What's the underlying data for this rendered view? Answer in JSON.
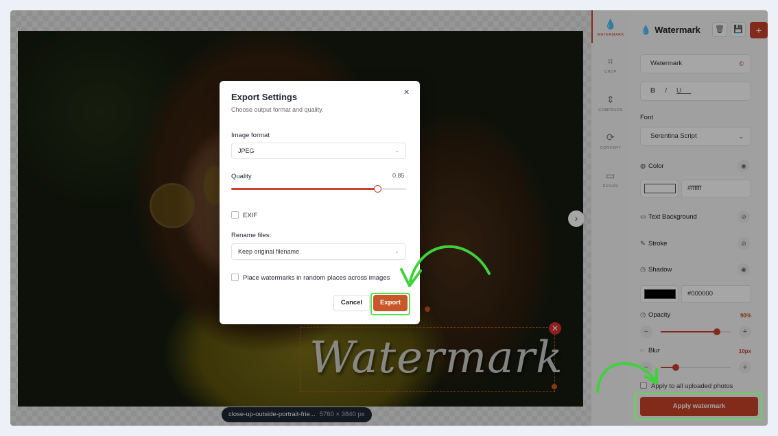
{
  "file": {
    "name": "close-up-outside-portrait-frie...",
    "dims": "5760 × 3840 px"
  },
  "canvas": {
    "watermark_text": "Watermark",
    "next_icon": "chevron-right-icon"
  },
  "rail": {
    "items": [
      {
        "label": "WATERMARK",
        "icon": "droplet-icon"
      },
      {
        "label": "CROP",
        "icon": "crop-icon"
      },
      {
        "label": "COMPRESS",
        "icon": "compress-icon"
      },
      {
        "label": "CONVERT",
        "icon": "convert-icon"
      },
      {
        "label": "RESIZE",
        "icon": "resize-icon"
      }
    ]
  },
  "panel": {
    "title": "Watermark",
    "text_value": "Watermark",
    "format_buttons": [
      "B",
      "I",
      "U"
    ],
    "font_label": "Font",
    "font_value": "Serentina Script",
    "color_label": "Color",
    "color_hex": "#ffffff",
    "text_bg_label": "Text Background",
    "stroke_label": "Stroke",
    "shadow_label": "Shadow",
    "shadow_hex": "#000000",
    "opacity_label": "Opacity",
    "opacity_value": "90%",
    "blur_label": "Blur",
    "blur_value": "10px",
    "apply_all_label": "Apply to all uploaded photos",
    "apply_button": "Apply watermark"
  },
  "dialog": {
    "title": "Export Settings",
    "subtitle": "Choose output format and quality.",
    "format_label": "Image format",
    "format_value": "JPEG",
    "quality_label": "Quality",
    "quality_value": "0.85",
    "exif_label": "EXIF",
    "rename_label": "Rename files:",
    "rename_value": "Keep original filename",
    "random_label": "Place watermarks in random places across images",
    "cancel": "Cancel",
    "export": "Export"
  },
  "colors": {
    "accent": "#c8432a",
    "highlight": "#54e14a",
    "pill": "#1e2533"
  }
}
